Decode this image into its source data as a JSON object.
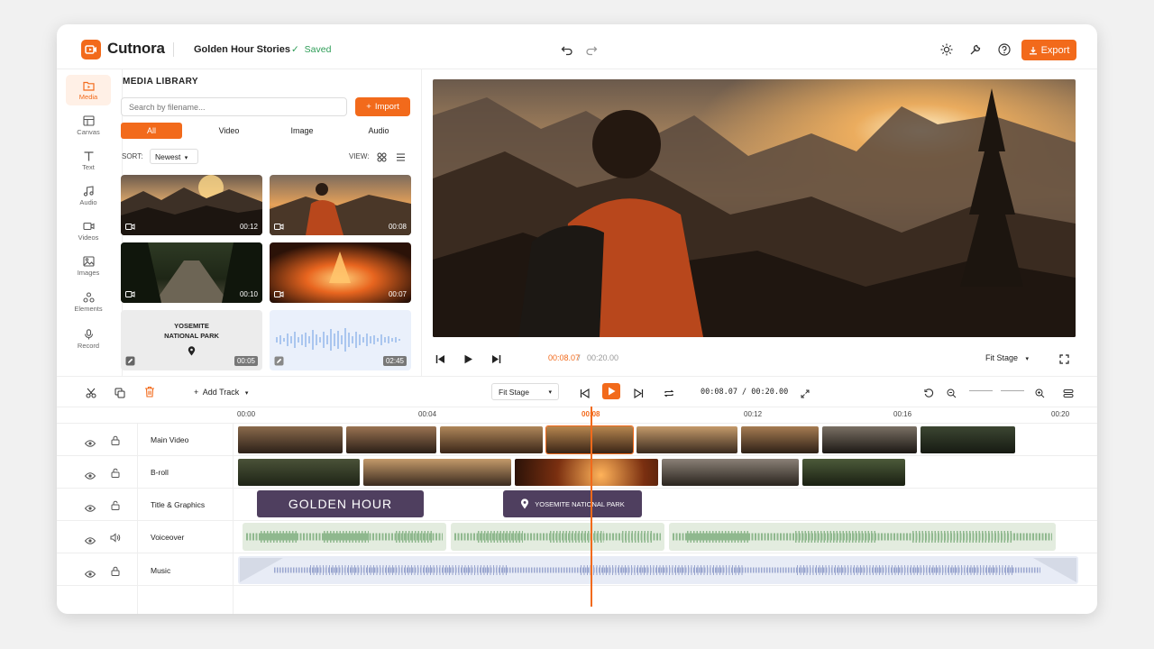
{
  "app": {
    "name": "Cutnora",
    "project": "Golden Hour Stories",
    "saved": "Saved",
    "export": "Export"
  },
  "sidebar": [
    {
      "label": "Media",
      "icon": "folder-icon"
    },
    {
      "label": "Canvas",
      "icon": "canvas-icon"
    },
    {
      "label": "Text",
      "icon": "text-icon"
    },
    {
      "label": "Audio",
      "icon": "music-icon"
    },
    {
      "label": "Videos",
      "icon": "video-icon"
    },
    {
      "label": "Images",
      "icon": "image-icon"
    },
    {
      "label": "Elements",
      "icon": "elements-icon"
    },
    {
      "label": "Record",
      "icon": "mic-icon"
    }
  ],
  "media": {
    "title": "MEDIA LIBRARY",
    "search_placeholder": "Search by filename...",
    "import": "Import",
    "tabs": [
      "All",
      "Video",
      "Image",
      "Audio"
    ],
    "sort_label": "SORT:",
    "sort_value": "Newest",
    "view_label": "VIEW:",
    "items": [
      {
        "type": "video",
        "duration": "00:12"
      },
      {
        "type": "video",
        "duration": "00:08"
      },
      {
        "type": "video",
        "duration": "00:10"
      },
      {
        "type": "video",
        "duration": "00:07"
      },
      {
        "type": "title",
        "duration": "00:05",
        "text": "YOSEMITE NATIONAL PARK"
      },
      {
        "type": "audio",
        "duration": "02:45"
      }
    ]
  },
  "player": {
    "current": "00:08.07",
    "separator": "/",
    "total": "00:20.00",
    "fit": "Fit Stage"
  },
  "toolbar": {
    "add_track": "Add Track",
    "fit": "Fit Stage",
    "timecode": "00:08.07 / 00:20.00"
  },
  "timeline": {
    "ruler": [
      "00:00",
      "00:04",
      "00:08",
      "00:12",
      "00:16",
      "00:20"
    ],
    "playhead": "00:08",
    "tracks": [
      {
        "name": "Main Video"
      },
      {
        "name": "B-roll"
      },
      {
        "name": "Title & Graphics"
      },
      {
        "name": "Voiceover"
      },
      {
        "name": "Music"
      }
    ],
    "title_clips": [
      "GOLDEN HOUR",
      "YOSEMITE NATIONAL PARK"
    ]
  },
  "colors": {
    "accent": "#f26a1b",
    "saved": "#2e9d57",
    "title_clip": "#4f3f5f",
    "voice_wave": "#8fb88e",
    "music_wave": "#9aa6cf"
  }
}
